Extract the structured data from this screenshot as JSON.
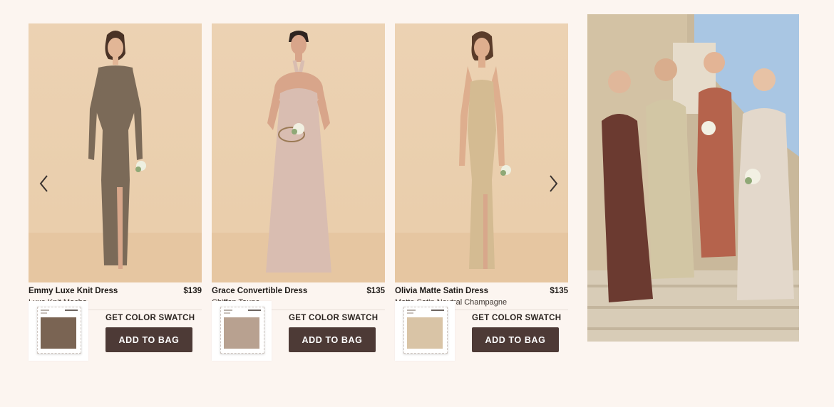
{
  "products": [
    {
      "name": "Emmy Luxe Knit Dress",
      "price": "$139",
      "color_name": "Luxe Knit Mocha",
      "dress_color": "#7b6a58",
      "fabric_color": "#7a6453",
      "get_swatch_label": "GET COLOR SWATCH",
      "add_to_bag_label": "ADD TO BAG"
    },
    {
      "name": "Grace Convertible Dress",
      "price": "$135",
      "color_name": "Chiffon Taupe",
      "dress_color": "#d9bdb1",
      "fabric_color": "#b8a190",
      "get_swatch_label": "GET COLOR SWATCH",
      "add_to_bag_label": "ADD TO BAG"
    },
    {
      "name": "Olivia Matte Satin Dress",
      "price": "$135",
      "color_name": "Matte Satin Neutral Champagne",
      "dress_color": "#d4bb92",
      "fabric_color": "#d9c4a6",
      "get_swatch_label": "GET COLOR SWATCH",
      "add_to_bag_label": "ADD TO BAG"
    }
  ],
  "carousel": {
    "prev_icon": "chevron-left-icon",
    "next_icon": "chevron-right-icon"
  },
  "lifestyle": {
    "dress_colors": [
      "#6b3a30",
      "#d2c6a4",
      "#b5634c",
      "#e3d8cb"
    ]
  },
  "colors": {
    "background": "#fcf5f0",
    "button": "#4d3a36"
  }
}
